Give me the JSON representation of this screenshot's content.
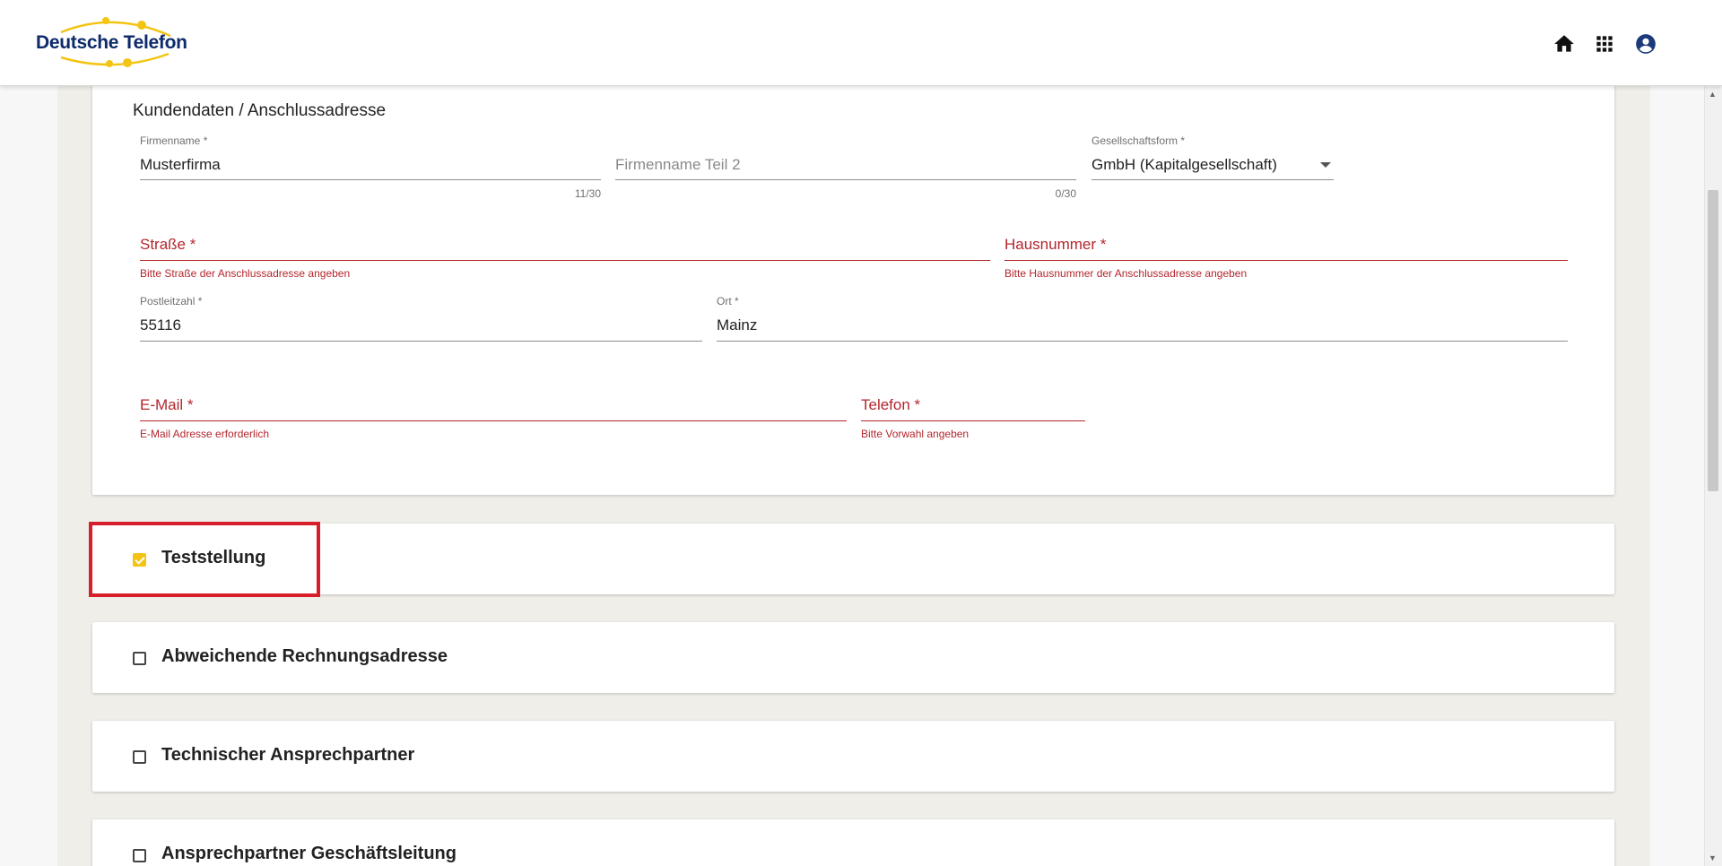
{
  "header": {
    "logo_text": "Deutsche Telefon",
    "icons": [
      "home-icon",
      "apps-grid-icon",
      "account-circle-icon"
    ]
  },
  "customer_section": {
    "title": "Kundendaten / Anschlussadresse",
    "company_name": {
      "label": "Firmenname *",
      "value": "Musterfirma",
      "counter": "11/30"
    },
    "company_name_2": {
      "placeholder": "Firmenname Teil 2",
      "counter": "0/30"
    },
    "legal_form": {
      "label": "Gesellschaftsform *",
      "value": "GmbH (Kapitalgesellschaft)"
    },
    "street": {
      "label": "Straße *",
      "error": "Bitte Straße der Anschlussadresse angeben"
    },
    "house_number": {
      "label": "Hausnummer *",
      "error": "Bitte Hausnummer der Anschlussadresse angeben"
    },
    "postal_code": {
      "label": "Postleitzahl *",
      "value": "55116"
    },
    "city": {
      "label": "Ort *",
      "value": "Mainz"
    },
    "email": {
      "label": "E-Mail *",
      "error": "E-Mail Adresse erforderlich"
    },
    "phone": {
      "label": "Telefon *",
      "error": "Bitte Vorwahl angeben"
    }
  },
  "panels": [
    {
      "label": "Teststellung",
      "checked": true
    },
    {
      "label": "Abweichende Rechnungsadresse",
      "checked": false
    },
    {
      "label": "Technischer Ansprechpartner",
      "checked": false
    },
    {
      "label": "Ansprechpartner Geschäftsleitung",
      "checked": false
    }
  ],
  "colors": {
    "brand_blue": "#0d2a6b",
    "brand_yellow": "#f3c413",
    "error_red": "#b3262d",
    "highlight_red": "#d81e2a",
    "page_background": "#efeee8"
  }
}
